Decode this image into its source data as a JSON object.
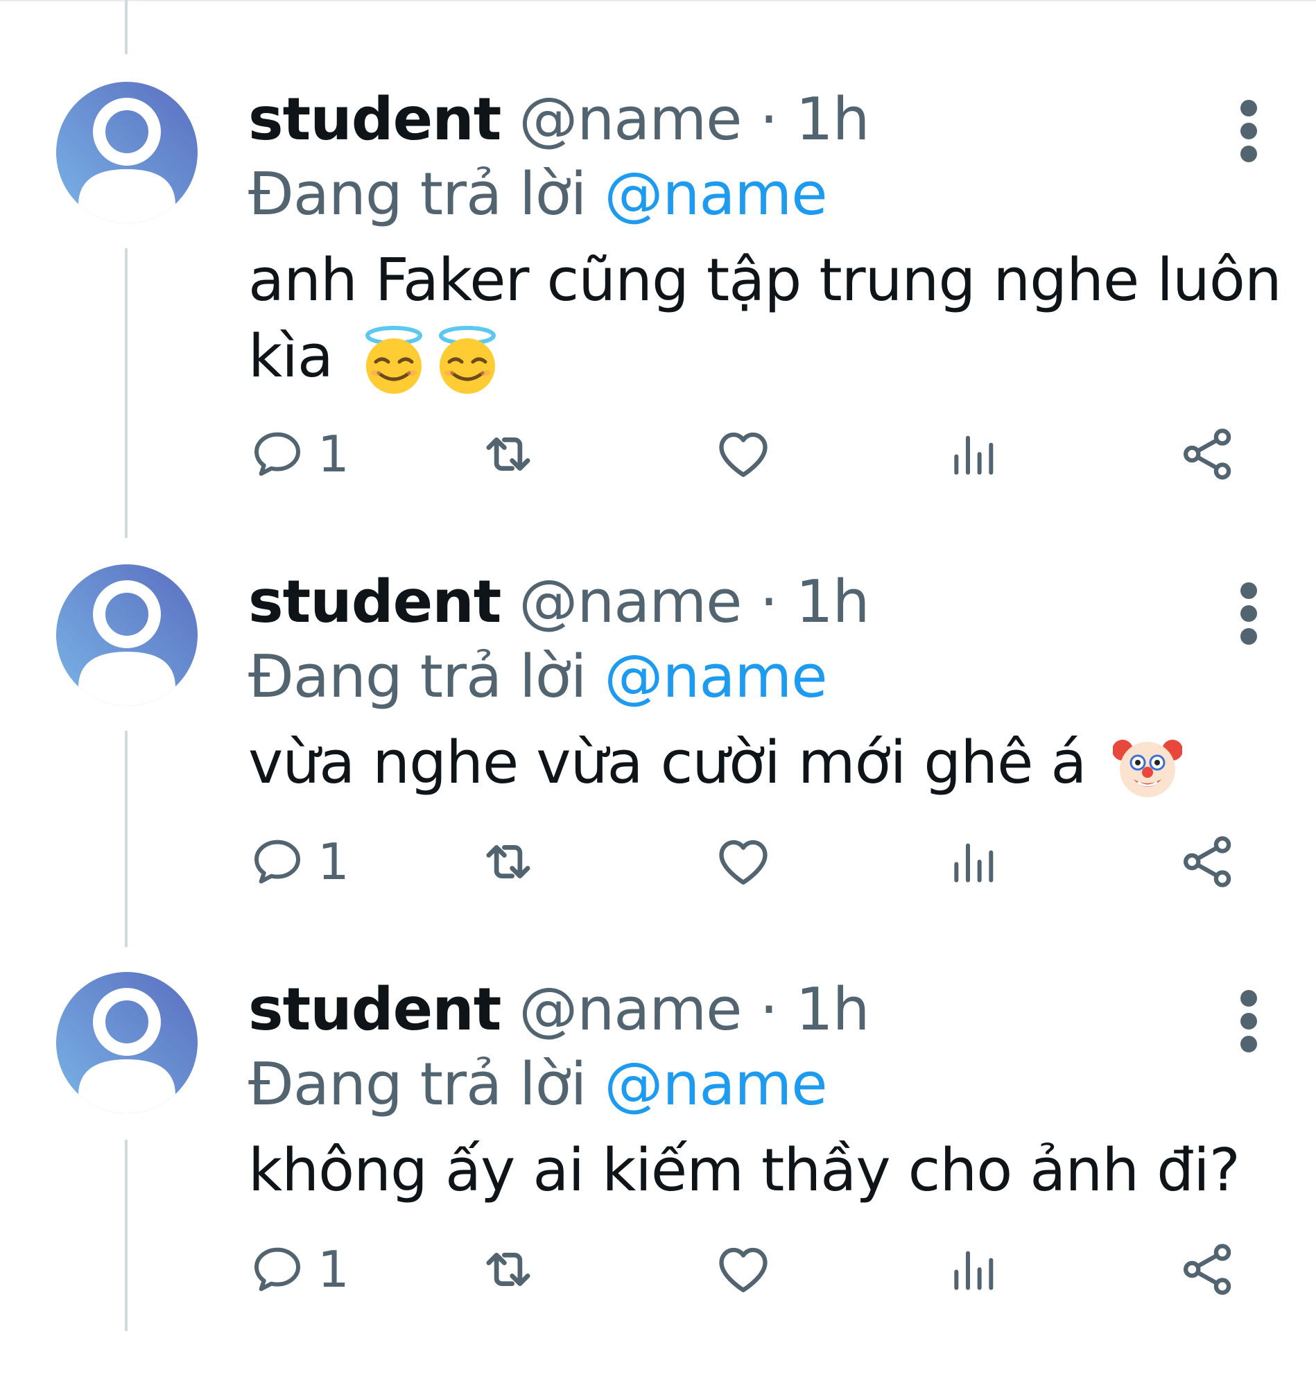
{
  "colors": {
    "text": "#0f1419",
    "muted": "#536471",
    "mention": "#1d9bf0",
    "thread_line": "#cfd9de"
  },
  "tweets": [
    {
      "author_name": "student",
      "handle": "@name",
      "separator": "·",
      "time": "1h",
      "reply_prefix": "Đang trả lời",
      "reply_to": "@name",
      "text": "anh Faker cũng tập trung nghe luôn kìa",
      "emojis": [
        "smiling-face-with-halo-emoji",
        "smiling-face-with-halo-emoji"
      ],
      "reply_count": "1"
    },
    {
      "author_name": "student",
      "handle": "@name",
      "separator": "·",
      "time": "1h",
      "reply_prefix": "Đang trả lời",
      "reply_to": "@name",
      "text": "vừa nghe vừa cười mới ghê á",
      "emojis": [
        "clown-face-emoji"
      ],
      "reply_count": "1"
    },
    {
      "author_name": "student",
      "handle": "@name",
      "separator": "·",
      "time": "1h",
      "reply_prefix": "Đang trả lời",
      "reply_to": "@name",
      "text": "không ấy ai kiếm thầy cho ảnh đi?",
      "emojis": [],
      "reply_count": "1"
    }
  ],
  "action_icons": [
    "reply-icon",
    "retweet-icon",
    "like-icon",
    "views-icon",
    "share-icon"
  ]
}
